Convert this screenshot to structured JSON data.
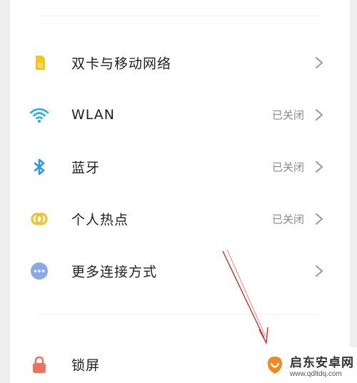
{
  "settings": {
    "items": [
      {
        "label": "双卡与移动网络",
        "status": "",
        "icon": "sim-card-icon"
      },
      {
        "label": "WLAN",
        "status": "已关闭",
        "icon": "wifi-icon"
      },
      {
        "label": "蓝牙",
        "status": "已关闭",
        "icon": "bluetooth-icon"
      },
      {
        "label": "个人热点",
        "status": "已关闭",
        "icon": "hotspot-icon"
      },
      {
        "label": "更多连接方式",
        "status": "",
        "icon": "more-icon"
      },
      {
        "label": "锁屏",
        "status": "",
        "icon": "lock-icon"
      }
    ]
  },
  "colors": {
    "sim": "#f5c518",
    "wifi": "#1fb3e6",
    "bluetooth": "#2a9bea",
    "hotspot": "#f2c12e",
    "more": "#8aa8ea",
    "lock": "#f0725c",
    "annotation": "#d62a2a"
  },
  "watermark": {
    "title": "启东安卓网",
    "url": "www.qdltdq.com"
  }
}
